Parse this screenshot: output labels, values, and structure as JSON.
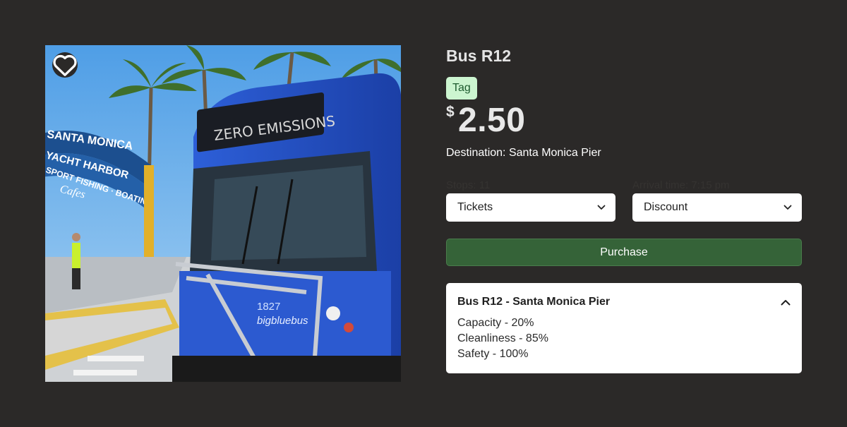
{
  "product": {
    "title": "Bus R12",
    "tag": "Tag",
    "price": {
      "currency": "$",
      "amount": "2.50"
    },
    "destination": "Destination: Santa Monica Pier",
    "stops_label": "Stops: 11",
    "arrival_label": "Arrival time: 7:15 pm",
    "tickets_select": "Tickets",
    "discount_select": "Discount",
    "purchase_label": "Purchase"
  },
  "photo": {
    "bus_sign": "ZERO EMISSIONS",
    "arch_line1": "SANTA MONICA",
    "arch_line2": "YACHT HARBOR",
    "arch_line3": "SPORT FISHING · BOATING",
    "arch_line4": "Cafes",
    "bus_number": "1827",
    "bus_brand": "bigbluebus"
  },
  "info_card": {
    "title": "Bus R12 - Santa Monica Pier",
    "items": [
      "Capacity - 20%",
      "Cleanliness - 85%",
      "Safety - 100%"
    ]
  },
  "colors": {
    "background": "#2b2928",
    "tag_bg": "#ccf5d0",
    "purchase_bg": "#356338",
    "bus_blue": "#2f5fd6"
  },
  "icons": {
    "favorite": "heart-icon",
    "select_caret": "chevron-down-icon",
    "card_toggle": "chevron-up-icon"
  }
}
